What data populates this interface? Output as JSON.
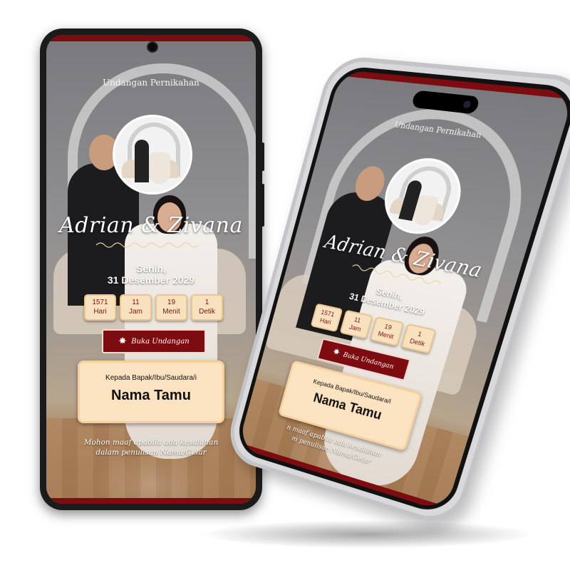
{
  "invitation": {
    "header": "Undangan Pernikahan",
    "couple": "Adrian & Zivana",
    "day": "Senin,",
    "date": "31 Desember 2029",
    "countdown": [
      {
        "value": "1571",
        "unit": "Hari"
      },
      {
        "value": "11",
        "unit": "Jam"
      },
      {
        "value": "19",
        "unit": "Menit"
      },
      {
        "value": "1",
        "unit": "Detik"
      }
    ],
    "open_button": "Buka Undangan",
    "to_label": "Kepada Bapak/Ibu/Saudara/i",
    "guest_name": "Nama Tamu",
    "note_line1": "Mohon maaf apabila ada kesalahan",
    "note_line2": "dalam penulisan Nama/Gelar"
  },
  "phone2_partial": {
    "note_line1": "n maaf apabila ada kesalahan",
    "note_line2": "m penulisan Nama/Gelar"
  },
  "icons": {
    "open_button_icon": "maple-leaf-icon"
  },
  "colors": {
    "accent": "#7d0c10",
    "card_bg": "#fbe2c0",
    "countdown_bg": "#f8e1bf",
    "countdown_text": "#7d1215"
  }
}
